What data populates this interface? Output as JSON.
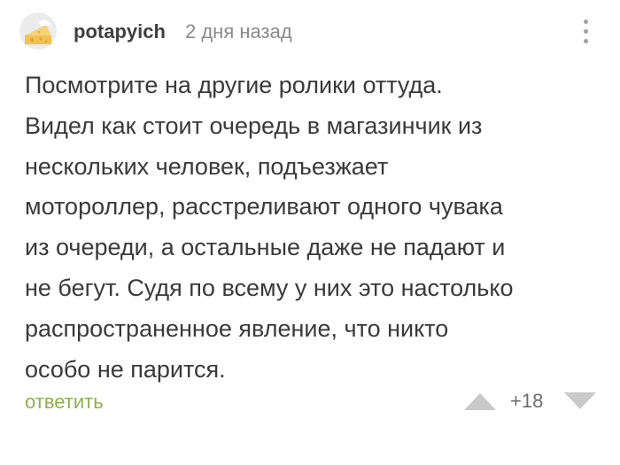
{
  "comment": {
    "author": "potapyich",
    "time": "2 дня назад",
    "text": "Посмотрите на другие ролики оттуда.\nВидел как стоит очередь в магазинчик из\nнескольких человек, подъезжает\nмотороллер, расстреливают одного чувака\nиз очереди, а остальные даже не падают и\nне бегут. Судя по всему у них это настолько\nраспространенное явление, что никто\nособо не парится.",
    "reply_label": "ответить",
    "rating": "+18"
  },
  "icons": {
    "avatar": "cheese-avatar-icon",
    "more": "more-vertical-icon",
    "vote_up": "triangle-up-icon",
    "vote_down": "triangle-down-icon"
  },
  "colors": {
    "reply": "#8cb04e",
    "text": "#3a3a3a",
    "muted": "#8a8a8a",
    "vote_arrow": "#c9c9c9"
  }
}
